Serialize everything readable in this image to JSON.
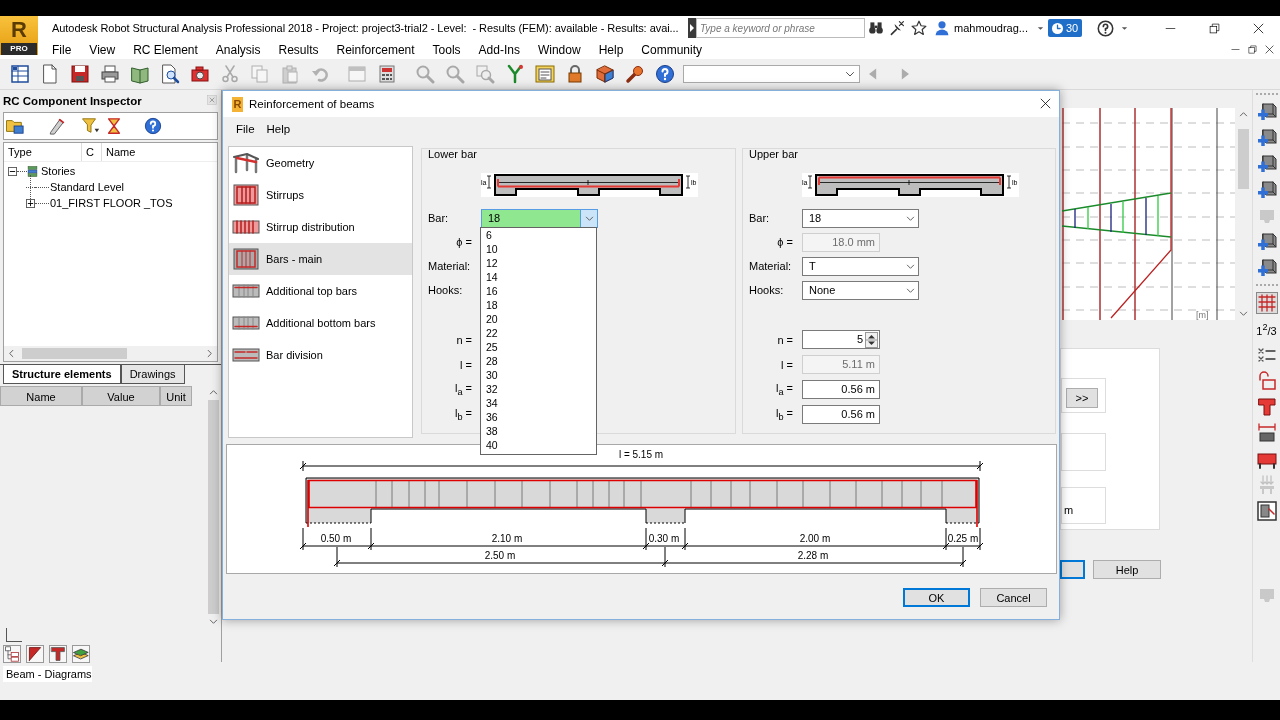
{
  "app_window": {
    "logo": {
      "letter": "R",
      "edition": "PRO"
    },
    "title": "Autodesk Robot Structural Analysis Professional 2018 - Project: project3-trial2 - Level:  - Results (FEM): available - Results: avai...",
    "search": {
      "placeholder": "Type a keyword or phrase"
    },
    "user": "mahmoudrag...",
    "notifications": "30"
  },
  "menu": [
    "File",
    "View",
    "RC Element",
    "Analysis",
    "Results",
    "Reinforcement",
    "Tools",
    "Add-Ins",
    "Window",
    "Help",
    "Community"
  ],
  "toolbar": {
    "buttons": [
      {
        "disabled": false
      },
      {
        "disabled": false
      },
      {
        "disabled": false
      },
      {
        "disabled": false
      },
      {
        "disabled": false
      },
      {
        "disabled": false
      },
      {
        "disabled": false
      },
      {
        "disabled": true
      },
      {
        "disabled": true
      },
      {
        "disabled": true
      },
      {
        "disabled": true
      },
      {
        "disabled": true
      },
      {
        "disabled": false
      },
      {
        "disabled": true
      },
      {
        "disabled": true
      },
      {
        "disabled": true
      },
      {
        "disabled": false
      },
      {
        "disabled": false
      },
      {
        "disabled": false
      },
      {
        "disabled": false
      },
      {
        "disabled": false
      },
      {
        "disabled": false
      }
    ],
    "nav": [
      {
        "disabled": true
      },
      {
        "disabled": true
      }
    ]
  },
  "inspector": {
    "title": "RC Component Inspector",
    "tree_columns": [
      "Type",
      "C",
      "Name"
    ],
    "tree": [
      {
        "label": "Stories",
        "kind": "group",
        "expanded": true,
        "children": [
          {
            "label": "Standard Level",
            "kind": "leaf"
          },
          {
            "label": "01_FIRST FLOOR _TOS",
            "kind": "group",
            "expanded": false
          }
        ]
      }
    ],
    "tabs": [
      {
        "label": "Structure elements",
        "selected": true
      },
      {
        "label": "Drawings",
        "selected": false
      }
    ],
    "grid_columns": [
      "Name",
      "Value",
      "Unit"
    ]
  },
  "dialog": {
    "logo": "R",
    "title": "Reinforcement of beams",
    "menu": [
      "File",
      "Help"
    ],
    "sections": [
      {
        "label": "Geometry",
        "selected": false
      },
      {
        "label": "Stirrups",
        "selected": false
      },
      {
        "label": "Stirrup distribution",
        "selected": false
      },
      {
        "label": "Bars - main",
        "selected": true
      },
      {
        "label": "Additional top bars",
        "selected": false
      },
      {
        "label": "Additional bottom bars",
        "selected": false
      },
      {
        "label": "Bar division",
        "selected": false
      }
    ],
    "groups": [
      {
        "title": "Lower bar",
        "kind": "lower",
        "diagram_labels": [
          "la",
          "lb"
        ],
        "rows": [
          {
            "label": "Bar:",
            "kind": "combo",
            "value": "18",
            "focused": true
          },
          {
            "label": "ϕ =",
            "kind": "readonly"
          },
          {
            "label": "Material:",
            "kind": "combo"
          },
          {
            "label": "Hooks:",
            "kind": "combo"
          },
          {
            "label": "n =",
            "kind": "spin"
          },
          {
            "label": "l =",
            "kind": "readonly"
          },
          {
            "label": "l$_{a}$ =",
            "kind": "input"
          },
          {
            "label": "l$_{b}$ =",
            "kind": "input"
          }
        ]
      },
      {
        "title": "Upper bar",
        "kind": "upper",
        "diagram_labels": [
          "la",
          "lb"
        ],
        "rows": [
          {
            "label": "Bar:",
            "kind": "combo",
            "value": "18",
            "focused": false
          },
          {
            "label": "ϕ =",
            "kind": "readonly",
            "value": "18.0 mm",
            "focused": false
          },
          {
            "label": "Material:",
            "kind": "combo",
            "value": "T",
            "focused": false
          },
          {
            "label": "Hooks:",
            "kind": "combo",
            "value": "None",
            "focused": false
          },
          {
            "label": "n =",
            "kind": "spin",
            "value": "5",
            "focused": false
          },
          {
            "label": "l =",
            "kind": "readonly",
            "value": "5.11 m",
            "focused": false
          },
          {
            "label": "l$_{a}$ =",
            "kind": "input",
            "value": "0.56 m",
            "focused": false
          },
          {
            "label": "l$_{b}$ =",
            "kind": "input",
            "value": "0.56 m",
            "focused": false
          }
        ]
      }
    ],
    "dropdown": {
      "items": [
        {
          "label": "6",
          "selected": false
        },
        {
          "label": "10",
          "selected": false
        },
        {
          "label": "12",
          "selected": false
        },
        {
          "label": "14",
          "selected": false
        },
        {
          "label": "16",
          "selected": false
        },
        {
          "label": "18",
          "selected": false
        },
        {
          "label": "20",
          "selected": false
        },
        {
          "label": "22",
          "selected": false
        },
        {
          "label": "25",
          "selected": false
        },
        {
          "label": "28",
          "selected": false
        },
        {
          "label": "30",
          "selected": false
        },
        {
          "label": "32",
          "selected": false
        },
        {
          "label": "34",
          "selected": false
        },
        {
          "label": "36",
          "selected": false
        },
        {
          "label": "38",
          "selected": false
        },
        {
          "label": "40",
          "selected": false
        }
      ]
    },
    "elevation": {
      "length": "l = 5.15 m",
      "segments": [
        "0.50 m",
        "2.10 m",
        "0.30 m",
        "2.00 m",
        "0.25 m"
      ],
      "spans": [
        "2.50 m",
        "2.28 m"
      ]
    },
    "buttons": [
      {
        "label": "OK",
        "default": true
      },
      {
        "label": "Cancel",
        "default": false
      }
    ]
  },
  "background_panel": {
    "unit": "[m]",
    "expand_button": ">>",
    "field_unit": "m",
    "buttons": [
      "Help"
    ]
  },
  "side_toolbar": [
    {
      "kind": "icon",
      "disabled": false,
      "pressed": false
    },
    {
      "kind": "icon",
      "disabled": false,
      "pressed": false
    },
    {
      "kind": "icon",
      "disabled": false,
      "pressed": false
    },
    {
      "kind": "icon",
      "disabled": false,
      "pressed": false
    },
    {
      "kind": "icon",
      "disabled": true,
      "pressed": false
    },
    {
      "kind": "icon",
      "disabled": false,
      "pressed": false
    },
    {
      "kind": "icon",
      "disabled": false,
      "pressed": false
    },
    {
      "kind": "icon",
      "disabled": false,
      "pressed": true
    },
    {
      "kind": "text",
      "text": "1$^{2}$/3",
      "disabled": false,
      "pressed": false
    },
    {
      "kind": "icon",
      "disabled": false,
      "pressed": false
    },
    {
      "kind": "icon",
      "disabled": false,
      "pressed": false
    },
    {
      "kind": "icon",
      "disabled": false,
      "pressed": false
    },
    {
      "kind": "icon",
      "disabled": false,
      "pressed": false
    },
    {
      "kind": "icon",
      "disabled": false,
      "pressed": false
    },
    {
      "kind": "icon",
      "disabled": true,
      "pressed": false
    },
    {
      "kind": "icon",
      "disabled": false,
      "pressed": false
    },
    {
      "kind": "icon",
      "disabled": true,
      "pressed": false
    }
  ],
  "status_bar": {
    "view": "Beam - Diagrams"
  }
}
